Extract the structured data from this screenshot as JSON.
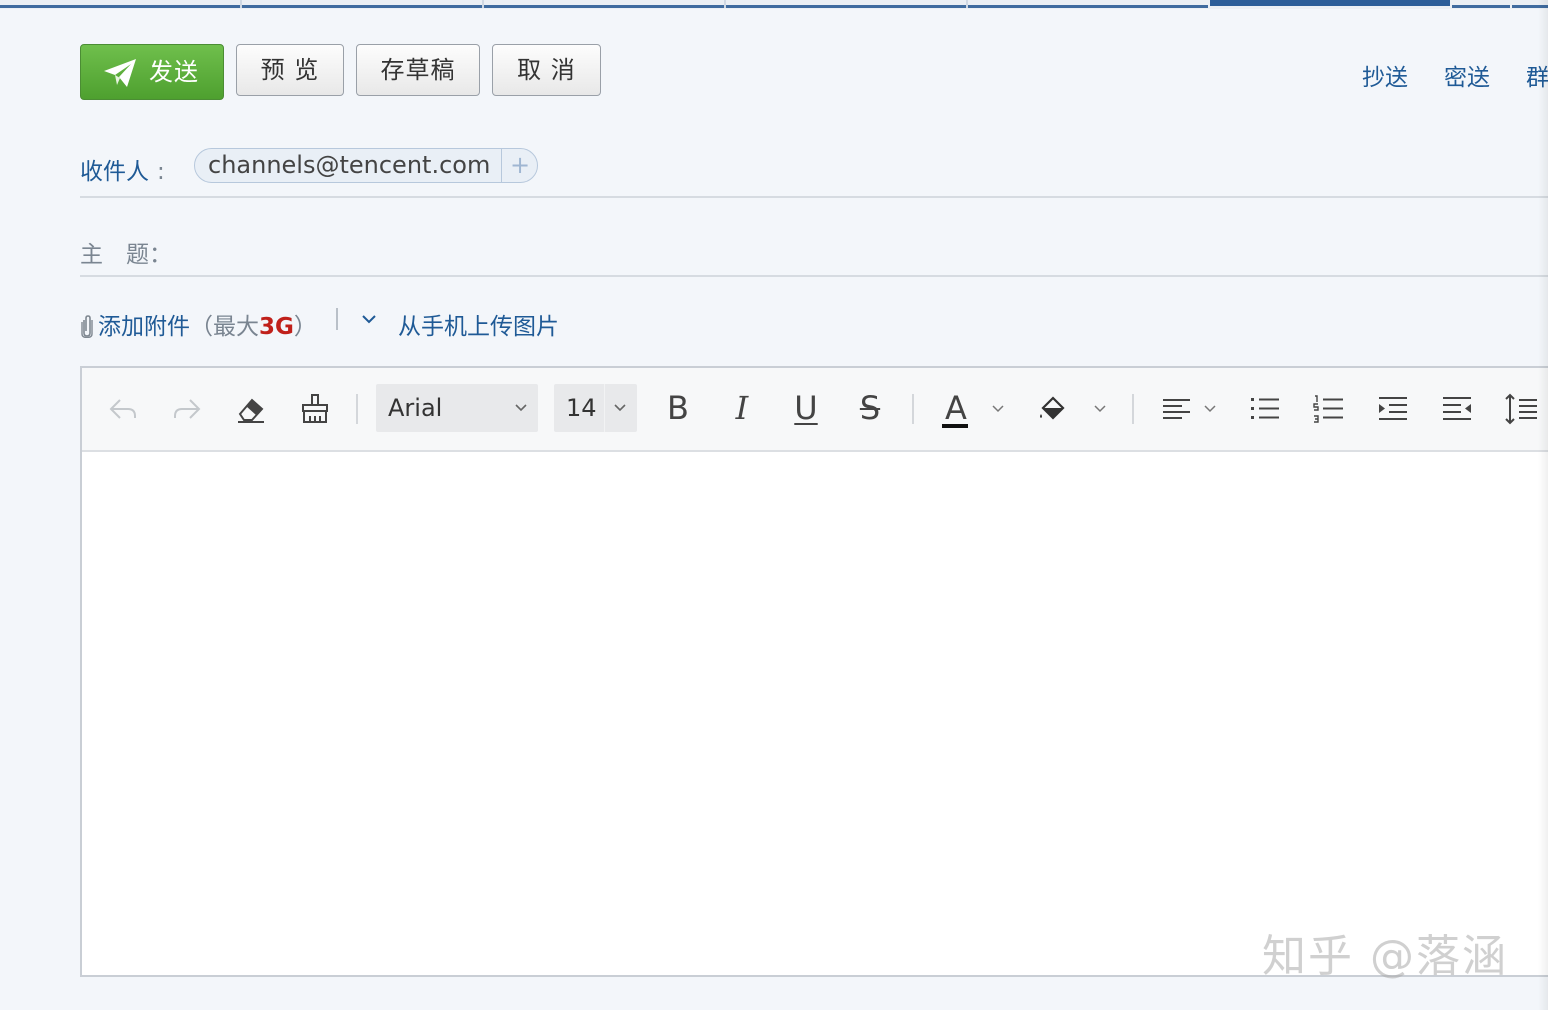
{
  "toolbar": {
    "send_label": "发送",
    "preview_label": "预 览",
    "draft_label": "存草稿",
    "cancel_label": "取 消"
  },
  "header_links": {
    "cc": "抄送",
    "bcc": "密送",
    "group": "群"
  },
  "recipient": {
    "label": "收件人",
    "colon": ":",
    "address": "channels@tencent.com",
    "add_symbol": "+"
  },
  "subject": {
    "label": "主　题：",
    "value": ""
  },
  "attachments": {
    "add_label": "添加附件",
    "open_paren": "（最大",
    "max_size": "3G",
    "close_paren": "）",
    "phone_upload": "从手机上传图片"
  },
  "editor": {
    "font_family": "Arial",
    "font_size": "14",
    "bold": "B",
    "italic": "I",
    "underline": "U",
    "strike": "S",
    "font_color": "A",
    "body": ""
  },
  "watermark": "知乎 @落涵",
  "colors": {
    "send_green": "#5aad36",
    "link_blue": "#1f5a96",
    "highlight_red": "#c0201a",
    "tab_active": "#2c5d98"
  }
}
